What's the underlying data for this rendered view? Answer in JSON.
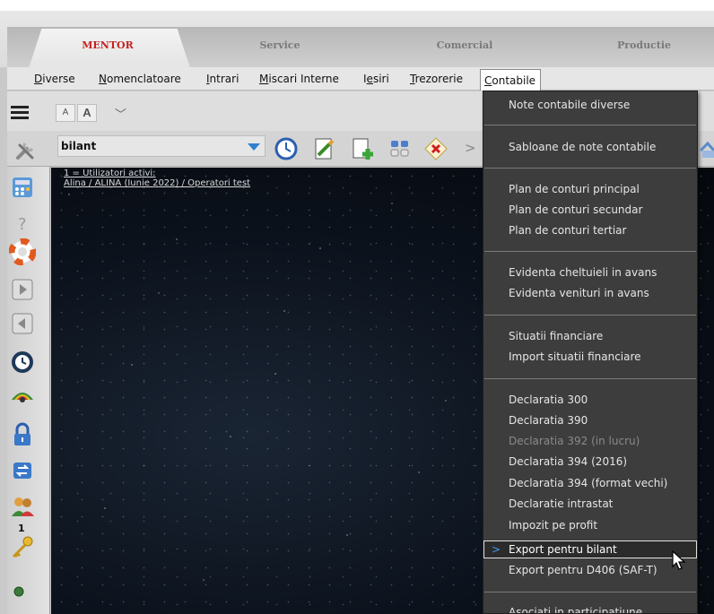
{
  "tabs": [
    "MENTOR",
    "Service",
    "Comercial",
    "Productie"
  ],
  "menu": {
    "items": [
      {
        "label": "Diverse",
        "accel": "D"
      },
      {
        "label": "Nomenclatoare",
        "accel": "N"
      },
      {
        "label": "Intrari",
        "accel": "I"
      },
      {
        "label": "Miscari Interne",
        "accel": "M"
      },
      {
        "label": "Iesiri",
        "accel": "e"
      },
      {
        "label": "Trezorerie",
        "accel": "T"
      },
      {
        "label": "Contabile",
        "accel": "C"
      }
    ]
  },
  "toolbar": {
    "font_small": "A",
    "font_large": "A",
    "expand_chevron": "﹀",
    "search_value": "bilant",
    "more_chevron": ">"
  },
  "status": {
    "line1": "1 = Utilizatori activi:",
    "line2": "Alina   / ALINA (Iunie 2022) / Operatori test"
  },
  "sidebar": {
    "badge_count": "1"
  },
  "contabile_menu": {
    "groups": [
      [
        {
          "label": "Note contabile diverse",
          "disabled": false
        }
      ],
      [
        {
          "label": "Sabloane de note contabile",
          "disabled": false
        }
      ],
      [
        {
          "label": "Plan de conturi principal",
          "disabled": false
        },
        {
          "label": "Plan de conturi secundar",
          "disabled": false
        },
        {
          "label": "Plan de conturi tertiar",
          "disabled": false
        }
      ],
      [
        {
          "label": "Evidenta cheltuieli in avans",
          "disabled": false
        },
        {
          "label": "Evidenta venituri in avans",
          "disabled": false
        }
      ],
      [
        {
          "label": "Situatii financiare",
          "disabled": false
        },
        {
          "label": "Import situatii financiare",
          "disabled": false
        }
      ],
      [
        {
          "label": "Declaratia 300",
          "disabled": false
        },
        {
          "label": "Declaratia 390",
          "disabled": false
        },
        {
          "label": "Declaratia 392 (in lucru)",
          "disabled": true
        },
        {
          "label": "Declaratia 394 (2016)",
          "disabled": false
        },
        {
          "label": "Declaratia 394 (format vechi)",
          "disabled": false
        },
        {
          "label": "Declaratie intrastat",
          "disabled": false
        },
        {
          "label": "Impozit pe profit",
          "disabled": false
        },
        {
          "label": "Export pentru bilant",
          "disabled": false,
          "selected": true
        },
        {
          "label": "Export pentru D406 (SAF-T)",
          "disabled": false
        }
      ],
      [
        {
          "label": "Asociati in participatiune",
          "disabled": false
        }
      ]
    ]
  },
  "colors": {
    "active_tab": "#c42222",
    "menu_bg": "#3d3d3d",
    "accent": "#2f7fd0"
  }
}
